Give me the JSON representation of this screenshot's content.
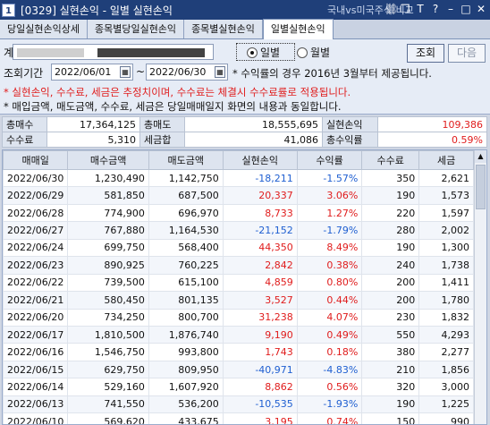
{
  "window": {
    "num": "1",
    "title": "[0329] 실현손익 - 일별 실현손익",
    "link": "국내vs미국주식 비교"
  },
  "tabs": [
    "당일실현손익상세",
    "종목별당일실현손익",
    "종목별실현손익",
    "일별실현손익"
  ],
  "controls": {
    "account_label": "계",
    "radio_daily": "일별",
    "radio_monthly": "월별",
    "query_label": "조회기간",
    "date_from": "2022/06/01",
    "date_to": "2022/06/30",
    "tilde": "~",
    "period_note": "* 수익률의 경우 2016년 3월부터 제공됩니다.",
    "btn_query": "조회",
    "btn_next": "다음"
  },
  "notes": [
    "* 실현손익, 수수료, 세금은 추정치이며, 수수료는 체결시 수수료률로 적용됩니다.",
    "* 매입금액, 매도금액, 수수료, 세금은 당일매매일지 화면의 내용과 동일합니다."
  ],
  "summary": {
    "buy_label": "총매수",
    "buy": "17,364,125",
    "sell_label": "총매도",
    "sell": "18,555,695",
    "pnl_label": "실현손익",
    "pnl": "109,386",
    "fee_label": "수수료",
    "fee": "5,310",
    "tax_label": "세금합",
    "tax": "41,086",
    "rate_label": "총수익률",
    "rate": "0.59%"
  },
  "grid": {
    "headers": [
      "매매일",
      "매수금액",
      "매도금액",
      "실현손익",
      "수익률",
      "수수료",
      "세금"
    ],
    "rows": [
      [
        "2022/06/30",
        "1,230,490",
        "1,142,750",
        "-18,211",
        "-1.57%",
        "350",
        "2,621"
      ],
      [
        "2022/06/29",
        "581,850",
        "687,500",
        "20,337",
        "3.06%",
        "190",
        "1,573"
      ],
      [
        "2022/06/28",
        "774,900",
        "696,970",
        "8,733",
        "1.27%",
        "220",
        "1,597"
      ],
      [
        "2022/06/27",
        "767,880",
        "1,164,530",
        "-21,152",
        "-1.79%",
        "280",
        "2,002"
      ],
      [
        "2022/06/24",
        "699,750",
        "568,400",
        "44,350",
        "8.49%",
        "190",
        "1,300"
      ],
      [
        "2022/06/23",
        "890,925",
        "760,225",
        "2,842",
        "0.38%",
        "240",
        "1,738"
      ],
      [
        "2022/06/22",
        "739,500",
        "615,100",
        "4,859",
        "0.80%",
        "200",
        "1,411"
      ],
      [
        "2022/06/21",
        "580,450",
        "801,135",
        "3,527",
        "0.44%",
        "200",
        "1,780"
      ],
      [
        "2022/06/20",
        "734,250",
        "800,700",
        "31,238",
        "4.07%",
        "230",
        "1,832"
      ],
      [
        "2022/06/17",
        "1,810,500",
        "1,876,740",
        "9,190",
        "0.49%",
        "550",
        "4,293"
      ],
      [
        "2022/06/16",
        "1,546,750",
        "993,800",
        "1,743",
        "0.18%",
        "380",
        "2,277"
      ],
      [
        "2022/06/15",
        "629,750",
        "809,950",
        "-40,971",
        "-4.83%",
        "210",
        "1,856"
      ],
      [
        "2022/06/14",
        "529,160",
        "1,607,920",
        "8,862",
        "0.56%",
        "320",
        "3,000"
      ],
      [
        "2022/06/13",
        "741,550",
        "536,200",
        "-10,535",
        "-1.93%",
        "190",
        "1,225"
      ],
      [
        "2022/06/10",
        "569,620",
        "433,675",
        "3,195",
        "0.74%",
        "150",
        "990"
      ]
    ]
  },
  "colors": {
    "positive": "#e01c1c",
    "negative": "#1f5fd1",
    "titlebar": "#1f3f79"
  }
}
